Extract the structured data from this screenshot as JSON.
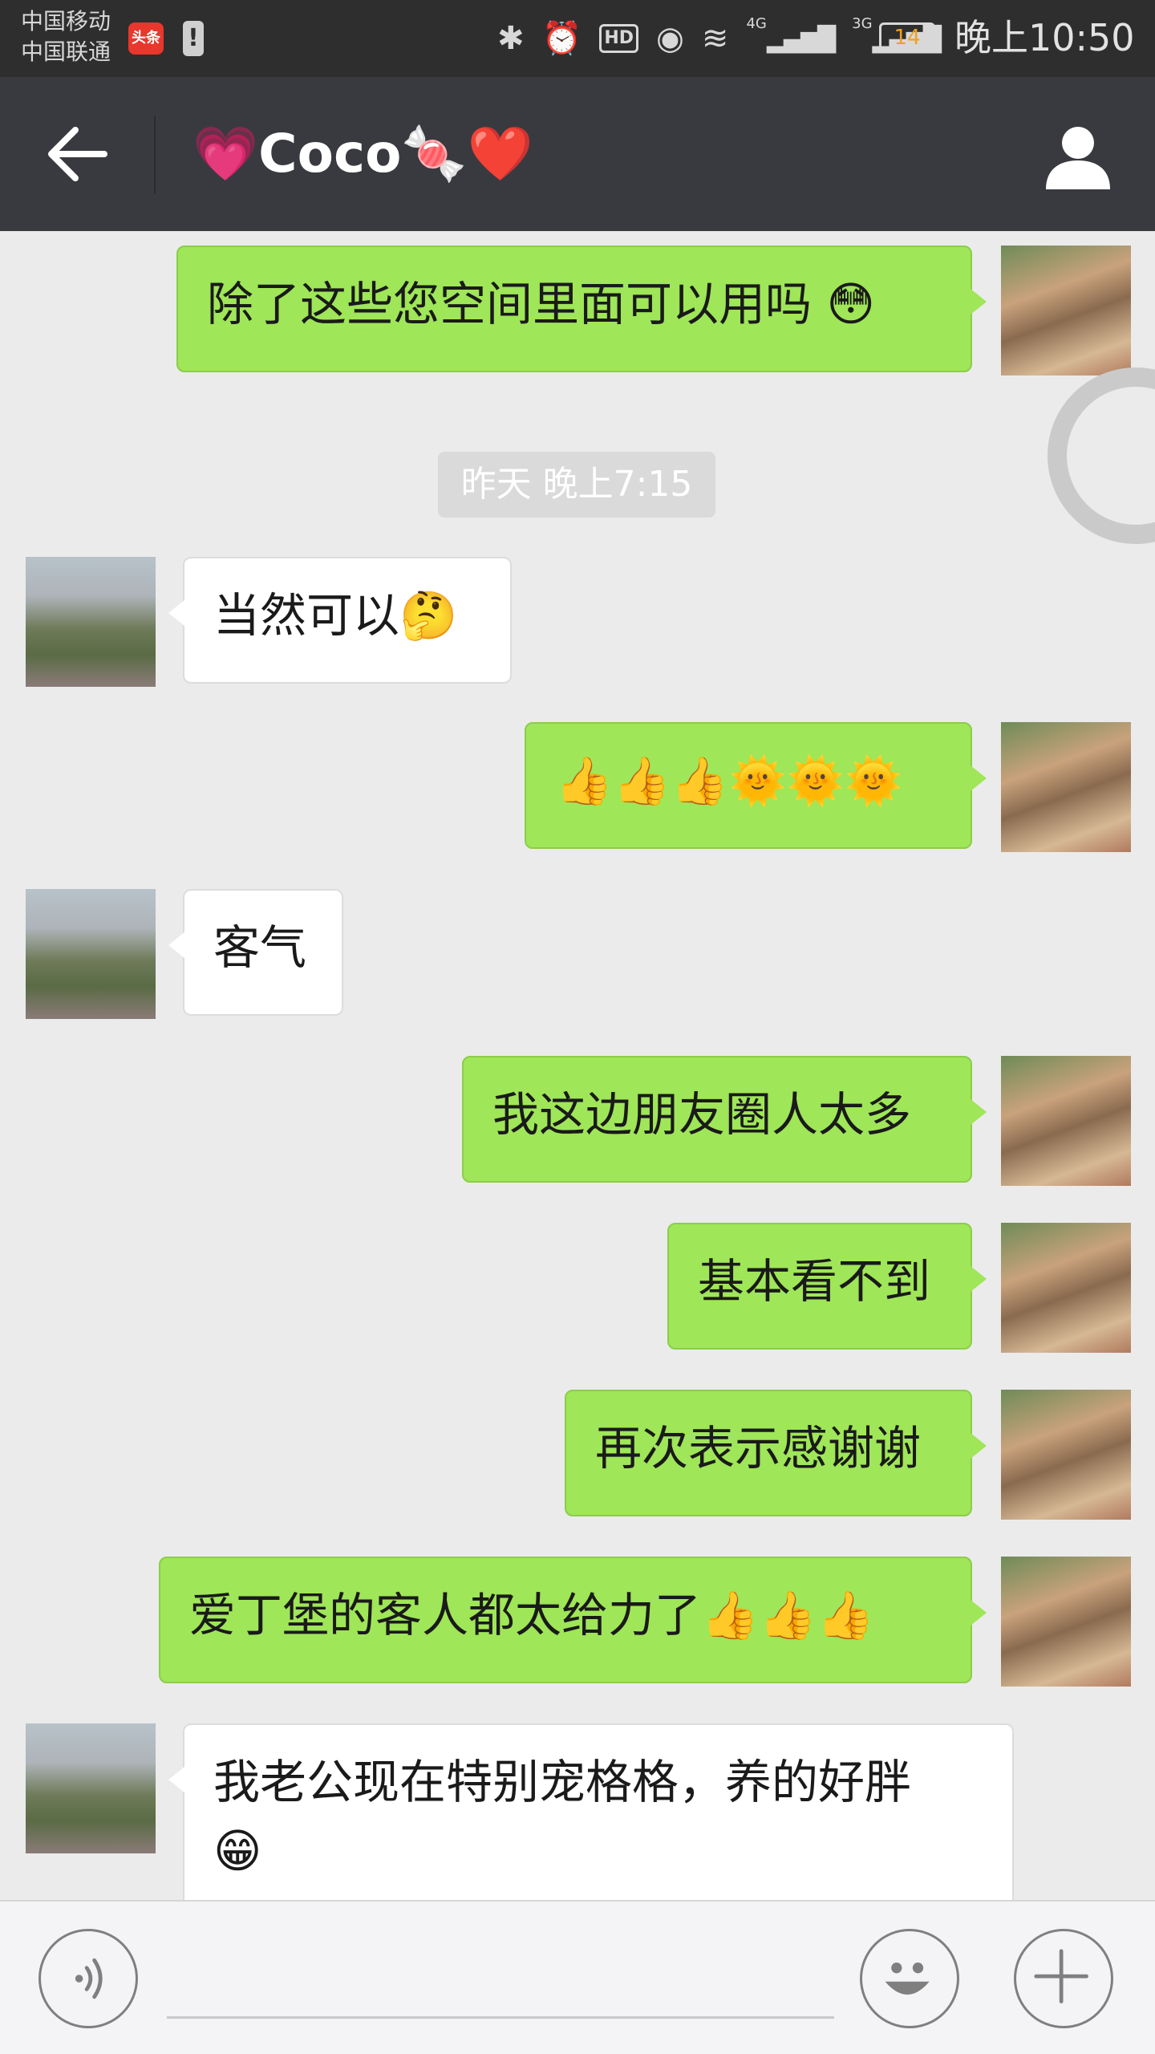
{
  "status_bar": {
    "carrier_top": "中国移动",
    "carrier_bottom": "中国联通",
    "news_badge": "头条",
    "signal_4g": "4G",
    "signal_3g": "3G",
    "hd_label": "HD",
    "battery": "14",
    "time": "晚上10:50"
  },
  "header": {
    "title": "💗Coco🍬❤️"
  },
  "messages": {
    "m1": "除了这些您空间里面可以用吗 😳",
    "timestamp": "昨天 晚上7:15",
    "m2": "当然可以🤔",
    "m3": "👍👍👍🌞🌞🌞",
    "m4": "客气",
    "m5": "我这边朋友圈人太多",
    "m6": "基本看不到",
    "m7": "再次表示感谢谢",
    "m8": "爱丁堡的客人都太给力了👍👍👍",
    "m9_line1": "我老公现在特别宠格格，养的好胖",
    "m9_line2": "😁"
  },
  "colors": {
    "outgoing_bubble": "#9fe658",
    "incoming_bubble": "#ffffff",
    "header_bg": "#393a3f",
    "chat_bg": "#ebebeb"
  }
}
